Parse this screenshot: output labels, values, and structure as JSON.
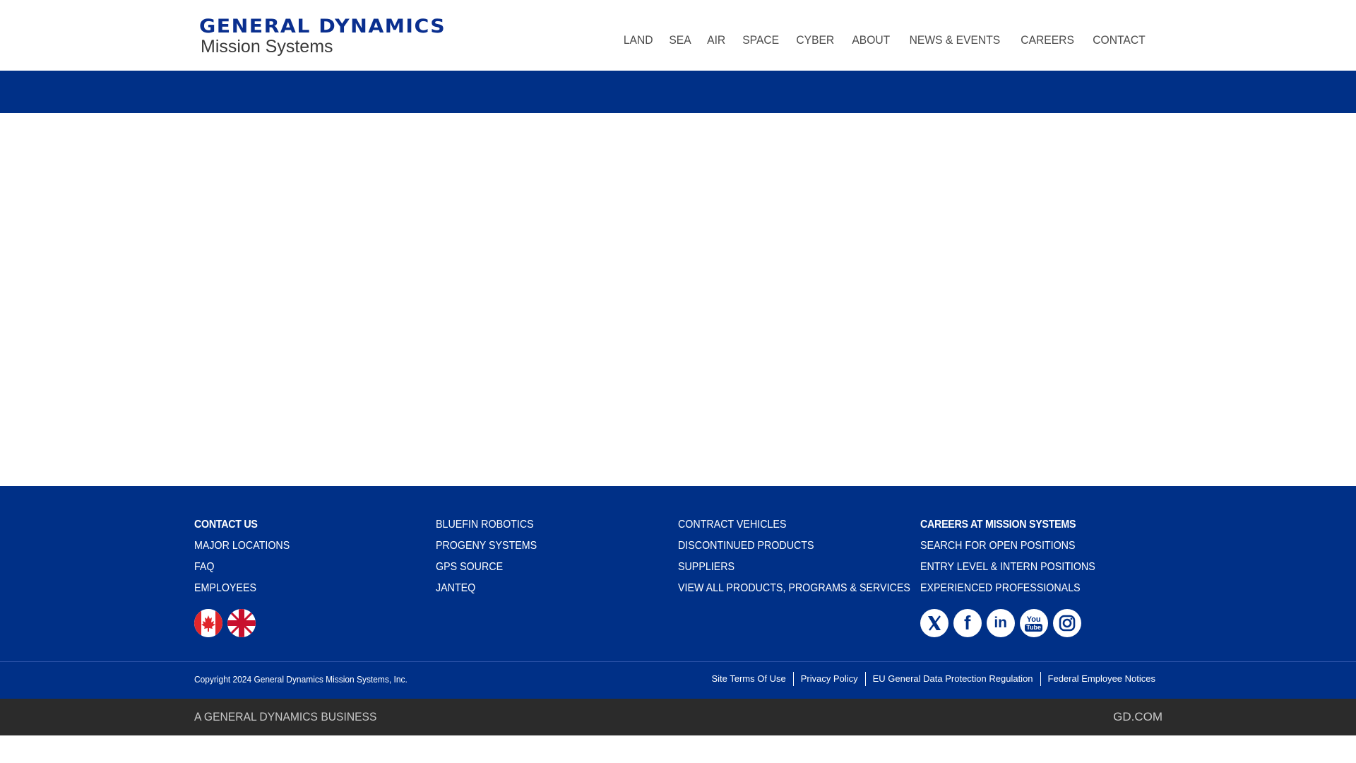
{
  "header": {
    "logo_top": "GENERAL DYNAMICS",
    "logo_bottom": "Mission Systems",
    "nav": [
      {
        "label": "LAND"
      },
      {
        "label": "SEA"
      },
      {
        "label": "AIR"
      },
      {
        "label": "SPACE"
      },
      {
        "label": "CYBER"
      },
      {
        "label": "ABOUT"
      },
      {
        "label": "NEWS & EVENTS"
      },
      {
        "label": "CAREERS"
      },
      {
        "label": "CONTACT"
      }
    ]
  },
  "colors": {
    "brand_blue": "#003087",
    "dark_bar": "#2b2b2b",
    "nav_text": "#4a4a4a"
  },
  "footer": {
    "col1": {
      "title": "CONTACT US",
      "links": [
        "MAJOR LOCATIONS",
        "FAQ",
        "EMPLOYEES"
      ],
      "flags": [
        "canada-flag-icon",
        "uk-flag-icon"
      ]
    },
    "col2": {
      "links": [
        "BLUEFIN ROBOTICS",
        "PROGENY SYSTEMS",
        "GPS SOURCE",
        "JANTEQ"
      ]
    },
    "col3": {
      "links": [
        "CONTRACT VEHICLES",
        "DISCONTINUED PRODUCTS",
        "SUPPLIERS",
        "VIEW ALL PRODUCTS, PROGRAMS & SERVICES"
      ]
    },
    "col4": {
      "title": "CAREERS AT MISSION SYSTEMS",
      "links": [
        "SEARCH FOR OPEN POSITIONS",
        "ENTRY LEVEL & INTERN POSITIONS",
        "EXPERIENCED PROFESSIONALS"
      ],
      "social": [
        "x-icon",
        "facebook-icon",
        "linkedin-icon",
        "youtube-icon",
        "instagram-icon"
      ],
      "social_text": {
        "facebook": "f",
        "linkedin": "in",
        "youtube_top": "You",
        "youtube_bottom": "Tube"
      }
    },
    "copyright": "Copyright 2024 General Dynamics Mission Systems, Inc.",
    "legal_links": [
      "Site Terms Of Use",
      "Privacy Policy",
      "EU General Data Protection Regulation",
      "Federal Employee Notices"
    ],
    "business": "A GENERAL DYNAMICS BUSINESS",
    "gd_link": "GD.COM"
  }
}
